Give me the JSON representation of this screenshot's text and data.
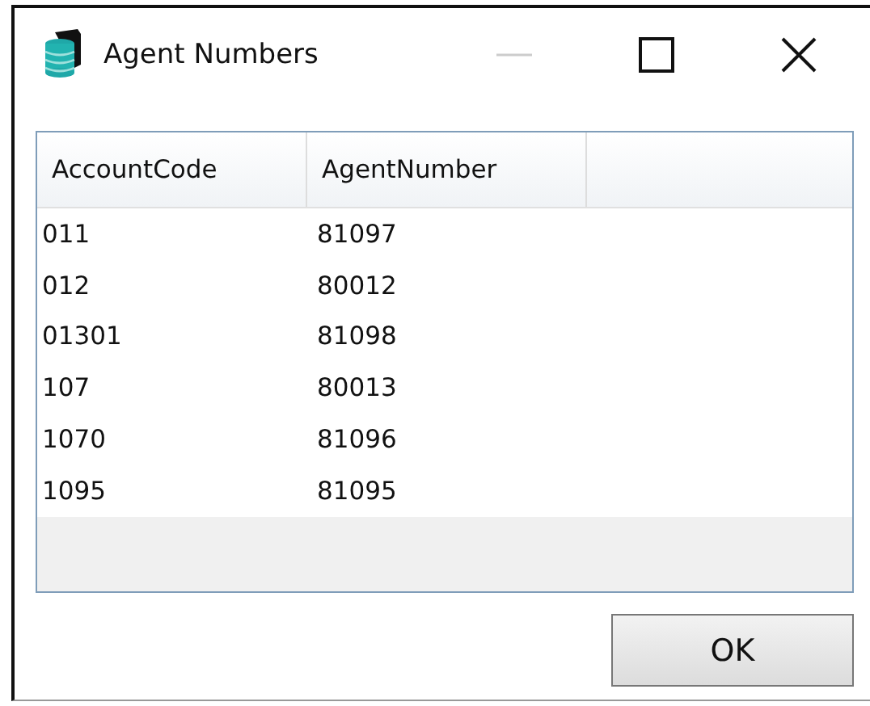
{
  "window": {
    "title": "Agent Numbers",
    "minimize_disabled": true
  },
  "table": {
    "columns": [
      "AccountCode",
      "AgentNumber"
    ],
    "rows": [
      [
        "011",
        "81097"
      ],
      [
        "012",
        "80012"
      ],
      [
        "01301",
        "81098"
      ],
      [
        "107",
        "80013"
      ],
      [
        "1070",
        "81096"
      ],
      [
        "1095",
        "81095"
      ]
    ]
  },
  "buttons": [
    "OK"
  ]
}
